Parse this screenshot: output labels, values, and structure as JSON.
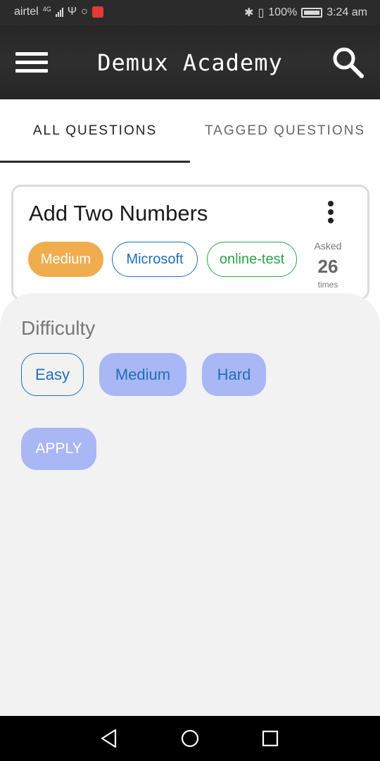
{
  "status_bar": {
    "carrier": "airtel",
    "network": "4G",
    "battery": "100%",
    "time": "3:24 am",
    "icons": [
      "usb-icon",
      "whatsapp-icon",
      "notification-badge-icon",
      "bluetooth-icon",
      "vibrate-icon",
      "battery-icon"
    ]
  },
  "app_bar": {
    "title": "Demux Academy",
    "menu_icon": "hamburger-menu-icon",
    "search_icon": "search-icon"
  },
  "tabs": [
    {
      "label": "ALL QUESTIONS",
      "active": true
    },
    {
      "label": "TAGGED QUESTIONS",
      "active": false
    }
  ],
  "question_card": {
    "title": "Add Two Numbers",
    "tags": {
      "difficulty": "Medium",
      "company": "Microsoft",
      "topic": "online-test"
    },
    "asked_label": "Asked",
    "asked_count": "26",
    "asked_unit": "times"
  },
  "filter_sheet": {
    "title": "Difficulty",
    "options": [
      {
        "label": "Easy",
        "selected": false
      },
      {
        "label": "Medium",
        "selected": true
      },
      {
        "label": "Hard",
        "selected": true
      }
    ],
    "apply_label": "APPLY"
  },
  "colors": {
    "app_bar": "#2b2b2b",
    "medium_tag": "#f0ad4e",
    "company_tag": "#1f6fb8",
    "topic_tag": "#28a745",
    "selected_chip": "#aab7f5",
    "sheet_bg": "#f2f2f2"
  }
}
